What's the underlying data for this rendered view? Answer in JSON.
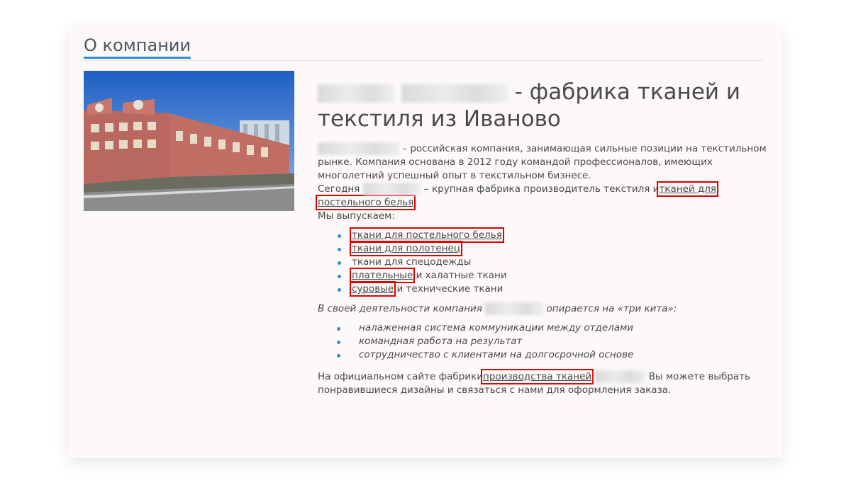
{
  "section_title": "О компании",
  "headline": {
    "rest": "- фабрика тканей и текстиля из Иваново"
  },
  "intro": {
    "p1": "– российская компания, занимающая сильные позиции на текстильном рынке. Компания основана в 2012 году командой профессионалов, имеющих многолетний успешный опыт в текстильном бизнесе.",
    "p2_start": "Сегодня",
    "p2_mid": "– крупная фабрика производитель текстиля и",
    "p2_link": "тканей для постельного белья",
    "p2_end": ".",
    "p3": "Мы выпускаем:"
  },
  "products": [
    {
      "link": "ткани для постельного белья",
      "rest": ""
    },
    {
      "link": "ткани для полотенец",
      "rest": ""
    },
    {
      "link": "",
      "rest": "ткани для спецодежды"
    },
    {
      "link": "плательные",
      "rest": " и халатные ткани"
    },
    {
      "link": "суровые",
      "rest": " и технические ткани"
    }
  ],
  "whales": {
    "intro_start": "В своей деятельности компания",
    "intro_end": "опирается на «три кита»:",
    "items": [
      "налаженная система коммуникации между отделами",
      "командная работа на результат",
      "сотрудничество с клиентами на долгосрочной основе"
    ]
  },
  "closing": {
    "start": "На официальном сайте фабрики",
    "link": "производства тканей",
    "end": "Вы можете выбрать понравившиеся дизайны и связаться с нами для оформления заказа."
  },
  "colors": {
    "accent": "#2f8fd6",
    "highlight": "#e00000",
    "card_bg": "#fcf9f8"
  }
}
